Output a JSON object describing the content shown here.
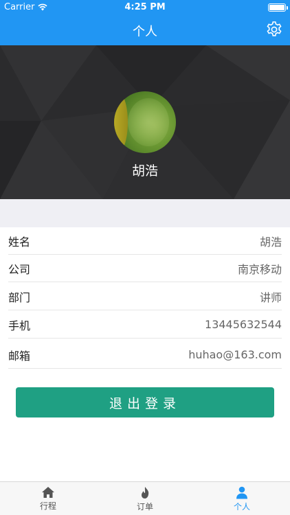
{
  "status_bar": {
    "carrier": "Carrier",
    "time": "4:25 PM"
  },
  "nav": {
    "title": "个人",
    "settings_icon": "gear-icon"
  },
  "profile": {
    "display_name": "胡浩"
  },
  "info": [
    {
      "label": "姓名",
      "value": "胡浩"
    },
    {
      "label": "公司",
      "value": "南京移动"
    },
    {
      "label": "部门",
      "value": "讲师"
    },
    {
      "label": "手机",
      "value": "13445632544"
    },
    {
      "label": "邮箱",
      "value": "huhao@163.com"
    }
  ],
  "logout_label": "退出登录",
  "tabs": [
    {
      "label": "行程",
      "icon": "home-icon"
    },
    {
      "label": "订单",
      "icon": "flame-icon"
    },
    {
      "label": "个人",
      "icon": "person-icon"
    }
  ],
  "colors": {
    "primary": "#2196f3",
    "logout": "#1fa083"
  }
}
